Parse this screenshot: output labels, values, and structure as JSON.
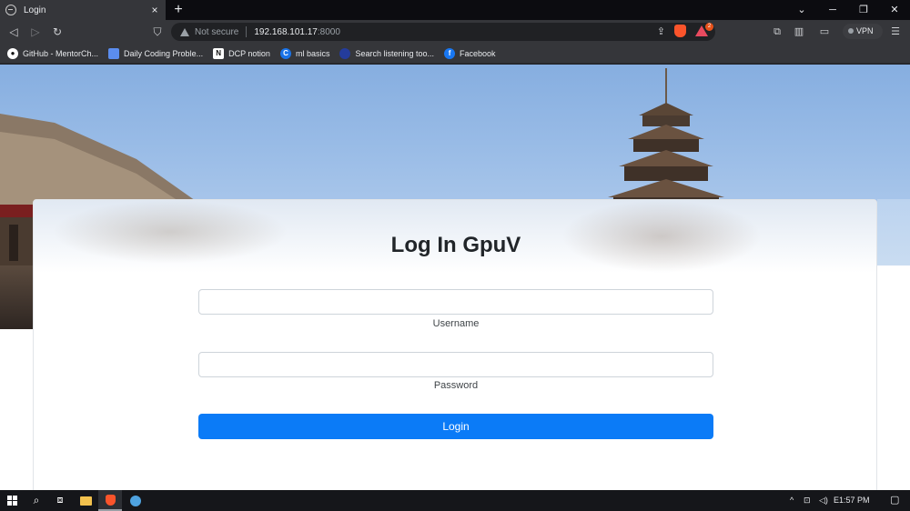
{
  "browser": {
    "tab": {
      "title": "Login",
      "close": "×"
    },
    "new_tab": "+",
    "window_controls": {
      "tabs_menu": "⌄",
      "minimize": "─",
      "restore": "❐",
      "close": "✕"
    },
    "nav": {
      "back": "◁",
      "forward": "▷",
      "reload": "↻",
      "bookmark": "⛉"
    },
    "address": {
      "security_text": "Not secure",
      "host": "192.168.101.17",
      "port": ":8000"
    },
    "rewards_badge": "2",
    "vpn_label": "VPN",
    "menu_icon": "☰",
    "bookmarks": [
      {
        "label": "GitHub - MentorCh...",
        "icon": "github-icon",
        "icon_color": "#ffffff",
        "icon_text": ""
      },
      {
        "label": "Daily Coding Proble...",
        "icon": "dcp-icon",
        "icon_color": "#5b8def",
        "icon_text": ""
      },
      {
        "label": "DCP notion",
        "icon": "notion-icon",
        "icon_color": "#ffffff",
        "icon_text": "N"
      },
      {
        "label": "ml basics",
        "icon": "c-icon",
        "icon_color": "#1a73e8",
        "icon_text": "C"
      },
      {
        "label": "Search listening too...",
        "icon": "search-listening-icon",
        "icon_color": "#243c9c",
        "icon_text": ""
      },
      {
        "label": "Facebook",
        "icon": "facebook-icon",
        "icon_color": "#1877f2",
        "icon_text": "f"
      }
    ]
  },
  "page": {
    "title": "Log In GpuV",
    "username": {
      "label": "Username",
      "value": "",
      "placeholder": ""
    },
    "password": {
      "label": "Password",
      "value": "",
      "placeholder": ""
    },
    "submit_label": "Login"
  },
  "taskbar": {
    "clock": "1:57 PM",
    "tray_chevron": "^"
  },
  "colors": {
    "accent": "#0b7bf7",
    "brave": "#fb542b",
    "chrome_bg": "#35363a"
  }
}
